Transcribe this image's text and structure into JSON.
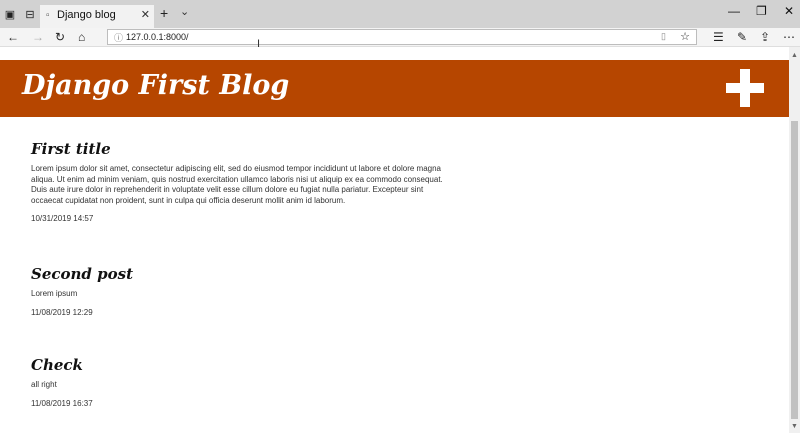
{
  "browser": {
    "tab_title": "Django blog",
    "tab_favicon": "blank-page-icon",
    "tab_close": "✕",
    "new_tab": "+",
    "tabs_dropdown": "⌄",
    "address": "127.0.0.1:8000/",
    "window_controls": [
      "—",
      "❐",
      "✕"
    ],
    "nav_icons": [
      "back-icon",
      "forward-icon",
      "refresh-icon",
      "home-icon"
    ],
    "toolbar_icons": [
      "favorites-icon",
      "pen-icon",
      "share-icon",
      "more-icon"
    ]
  },
  "site": {
    "title": "Django First Blog",
    "header_color": "#b64600",
    "add_icon": "plus-icon"
  },
  "posts": [
    {
      "title": "First title",
      "body": "Lorem ipsum dolor sit amet, consectetur adipiscing elit, sed do eiusmod tempor incididunt ut labore et dolore magna aliqua. Ut enim ad minim veniam, quis nostrud exercitation ullamco laboris nisi ut aliquip ex ea commodo consequat. Duis aute irure dolor in reprehenderit in voluptate velit esse cillum dolore eu fugiat nulla pariatur. Excepteur sint occaecat cupidatat non proident, sunt in culpa qui officia deserunt mollit anim id laborum.",
      "date": "10/31/2019 14:57"
    },
    {
      "title": "Second post",
      "body": "Lorem ipsum",
      "date": "11/08/2019 12:29"
    },
    {
      "title": "Check",
      "body": "all right",
      "date": "11/08/2019 16:37"
    }
  ]
}
